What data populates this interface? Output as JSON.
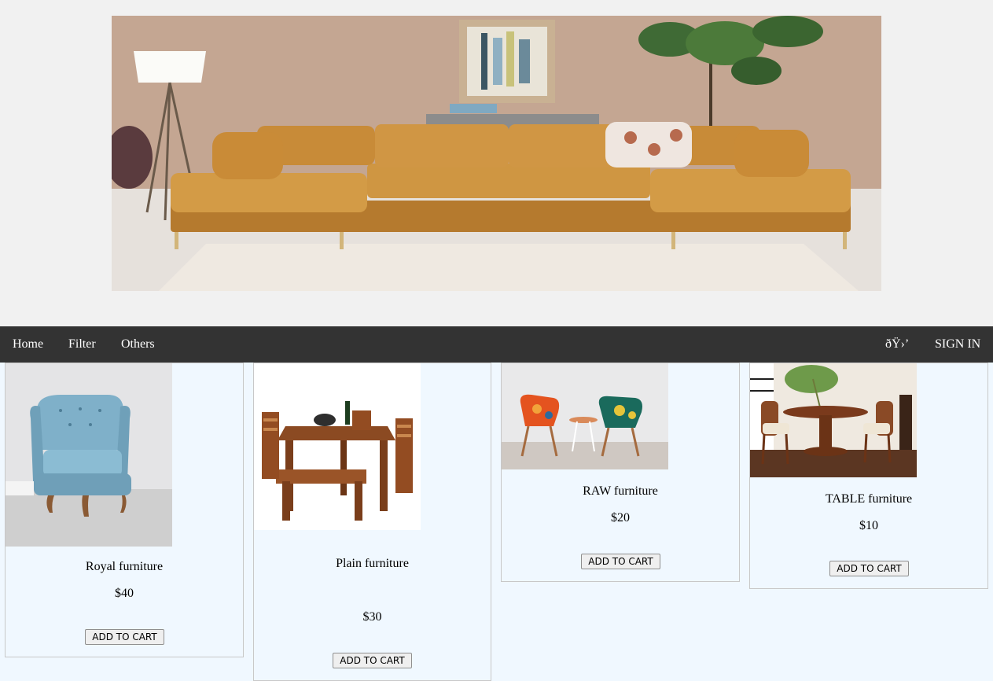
{
  "nav": {
    "left_items": [
      "Home",
      "Filter",
      "Others"
    ],
    "icon_text": "ðŸ›’",
    "sign_in": "SIGN IN"
  },
  "products": [
    {
      "name": "Royal furniture",
      "price": "$40",
      "button": "ADD TO CART"
    },
    {
      "name": "Plain furniture",
      "price": "$30",
      "button": "ADD TO CART"
    },
    {
      "name": "RAW furniture",
      "price": "$20",
      "button": "ADD TO CART"
    },
    {
      "name": "TABLE furniture",
      "price": "$10",
      "button": "ADD TO CART"
    }
  ],
  "colors": {
    "nav_bg": "#333333",
    "content_bg": "#f0f8ff",
    "page_bg": "#f1f1f1"
  }
}
